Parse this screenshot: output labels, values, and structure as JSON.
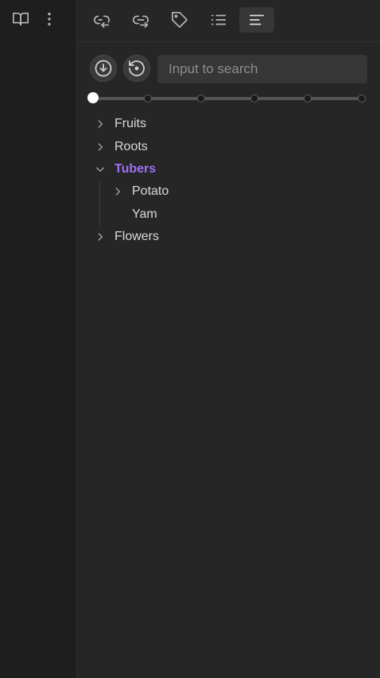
{
  "ribbon": {
    "items": [
      {
        "icon": "book-open-icon"
      },
      {
        "icon": "more-vertical-icon"
      }
    ]
  },
  "toolbar": {
    "tabs": [
      {
        "icon": "backlinks-icon",
        "active": false
      },
      {
        "icon": "outgoing-links-icon",
        "active": false
      },
      {
        "icon": "tags-icon",
        "active": false
      },
      {
        "icon": "outline-list-icon",
        "active": false
      },
      {
        "icon": "align-left-icon",
        "active": true
      }
    ]
  },
  "search": {
    "placeholder": "Input to search",
    "value": "",
    "buttons": [
      {
        "icon": "download-circle-icon"
      },
      {
        "icon": "history-reset-icon"
      }
    ]
  },
  "level_slider": {
    "stops": 6,
    "value_index": 0
  },
  "tree": {
    "items": [
      {
        "label": "Fruits",
        "expanded": false,
        "has_children": true,
        "active": false,
        "depth": 0
      },
      {
        "label": "Roots",
        "expanded": false,
        "has_children": true,
        "active": false,
        "depth": 0
      },
      {
        "label": "Tubers",
        "expanded": true,
        "has_children": true,
        "active": true,
        "depth": 0
      },
      {
        "label": "Potato",
        "expanded": false,
        "has_children": true,
        "active": false,
        "depth": 1
      },
      {
        "label": "Yam",
        "expanded": false,
        "has_children": false,
        "active": false,
        "depth": 1
      },
      {
        "label": "Flowers",
        "expanded": false,
        "has_children": true,
        "active": false,
        "depth": 0
      }
    ]
  },
  "colors": {
    "accent": "#9f6ff2",
    "background": "#262626",
    "ribbon": "#1e1e1e",
    "text": "#dadada"
  }
}
